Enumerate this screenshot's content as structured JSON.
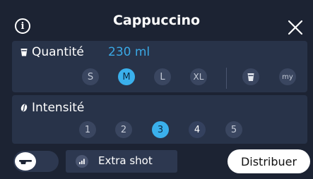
{
  "header": {
    "title": "Cappuccino",
    "info_icon": "info-icon",
    "info_glyph": "i",
    "close_icon": "close-icon"
  },
  "quantity": {
    "label": "Quantité",
    "value": "230 ml",
    "value_color": "#3aa9e6",
    "sizes": [
      "S",
      "M",
      "L",
      "XL"
    ],
    "selected_size": "M",
    "extra_options": [
      {
        "icon": "cup-icon"
      },
      {
        "label": "my"
      }
    ]
  },
  "intensity": {
    "label": "Intensité",
    "levels": [
      "1",
      "2",
      "3",
      "4",
      "5"
    ],
    "selected_level": "3"
  },
  "footer": {
    "toggle_icon": "milk-toggle-icon",
    "extra_shot_label": "Extra shot",
    "extra_shot_icon": "strength-bars-icon",
    "dispense_label": "Distribuer"
  },
  "colors": {
    "background": "#1c2333",
    "panel": "#283349",
    "accent": "#3ab0ec"
  }
}
